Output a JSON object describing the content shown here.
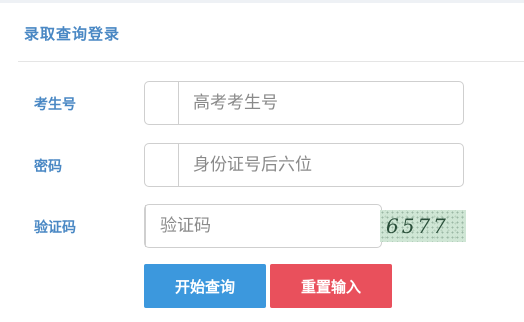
{
  "panel": {
    "title": "录取查询登录"
  },
  "fields": {
    "exam_id": {
      "label": "考生号",
      "placeholder": "高考考生号",
      "value": ""
    },
    "password": {
      "label": "密码",
      "placeholder": "身份证号后六位",
      "value": ""
    },
    "captcha": {
      "label": "验证码",
      "placeholder": "验证码",
      "value": "",
      "image_text": "6577"
    }
  },
  "buttons": {
    "query_label": "开始查询",
    "reset_label": "重置输入"
  },
  "colors": {
    "label": "#4a88c4",
    "query_button": "#3c98dd",
    "reset_button": "#e9505c"
  }
}
